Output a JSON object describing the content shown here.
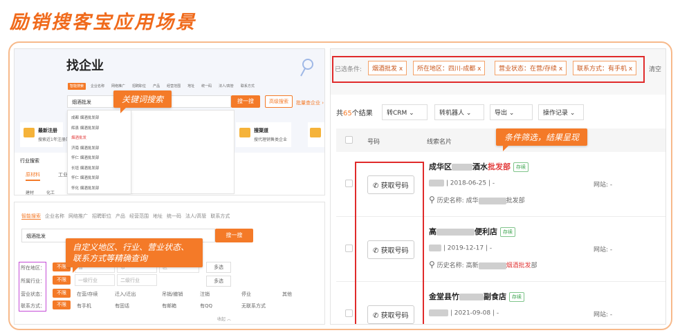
{
  "title": "励销搜客宝应用场景",
  "ann": {
    "keyword": "关键词搜索",
    "custom": "自定义地区、行业、营业状态、联系方式等精确查询",
    "filter": "条件筛选，结果呈现"
  },
  "p1": {
    "heading": "找企业",
    "tabs": [
      "智能搜索",
      "企业名称",
      "网络推广",
      "招聘职位",
      "产品",
      "经营范围",
      "地址",
      "统一码",
      "法人/高管",
      "联系方式"
    ],
    "search_value": "烟酒批发",
    "search_btn": "搜一搜",
    "adv_btn": "高级搜索",
    "recent": "批量查企业 ›",
    "suggest": [
      "成都   烟酒批发部",
      "辉县   烟酒批发部",
      "烟酒批发",
      "济南   烟酒批发部",
      "怀仁   烟酒批发部",
      "长垣   烟酒批发部",
      "怀仁   烟酒批发部",
      "怀化   烟酒批发部"
    ],
    "card1_title": "最新注册",
    "card1_sub": "搜索近1年注册的企业",
    "card2_title": "搜渠道",
    "card2_sub": "搜代理销售类企业",
    "industry_title": "行业搜索",
    "industry_tabs": [
      "原材料",
      "工业"
    ],
    "industry_items": [
      "建材",
      "化工",
      "",
      "",
      "",
      "",
      "",
      ""
    ]
  },
  "p2": {
    "tabs": [
      "智能搜索",
      "企业名称",
      "网络推广",
      "招聘职位",
      "产品",
      "经营范围",
      "地址",
      "统一码",
      "法人/高管",
      "联系方式"
    ],
    "search_value": "烟酒批发",
    "search_btn": "搜一搜",
    "labels": [
      "所在地区：",
      "所属行业：",
      "营业状态：",
      "联系方式："
    ],
    "unlimited": "不限",
    "region_selects": [
      "省",
      "市",
      "区"
    ],
    "industry_selects": [
      "一级行业",
      "二级行业"
    ],
    "multi": "多选",
    "status_opts": [
      "在营/存续",
      "迁入/迁出",
      "吊销/撤销",
      "注销",
      "停业",
      "其他"
    ],
    "contact_opts": [
      "有手机",
      "有固话",
      "有邮箱",
      "有QQ",
      "无联系方式"
    ],
    "collapse": "收起 ︿"
  },
  "p3": {
    "cond_label": "已选条件:",
    "tags": [
      "烟酒批发 x",
      "所在地区：四川-成都 x",
      "营业状态：在营/存续 x",
      "联系方式：有手机 x"
    ],
    "clear": "清空",
    "count_prefix": "共",
    "count": "65",
    "count_suffix": "个结果",
    "actions": [
      "转CRM",
      "转机器人",
      "导出",
      "操作记录"
    ],
    "col_num": "号码",
    "col_name": "线索名片",
    "get_num": "获取号码",
    "rows": [
      {
        "name_a": "成华区",
        "name_b": "酒水",
        "name_c": "批发部",
        "status": "存续",
        "date": "2018-06-25",
        "sep": "-",
        "site": "网站: -",
        "hist_prefix": "历史名称: 成华",
        "hist_hl": "",
        "hist_suffix": "批发部"
      },
      {
        "name_a": "高",
        "name_b": "",
        "name_c": "便利店",
        "status": "存续",
        "date": "2019-12-17",
        "sep": "-",
        "site": "网站: -",
        "hist_prefix": "历史名称: 高新",
        "hist_hl": "烟酒批发",
        "hist_suffix": "部"
      },
      {
        "name_a": "金堂县竹",
        "name_b": "",
        "name_c": "副食店",
        "status": "存续",
        "date": "2021-09-08",
        "sep": "-",
        "site": "网站: -",
        "hist_prefix": "",
        "hist_hl": "",
        "hist_suffix": ""
      }
    ]
  },
  "colors": {
    "accent": "#f47a28",
    "frame": "#f7b98a",
    "highlight_box": "#e02a2a",
    "purple_box": "#c44bd6",
    "status_green": "#3aa34c"
  }
}
